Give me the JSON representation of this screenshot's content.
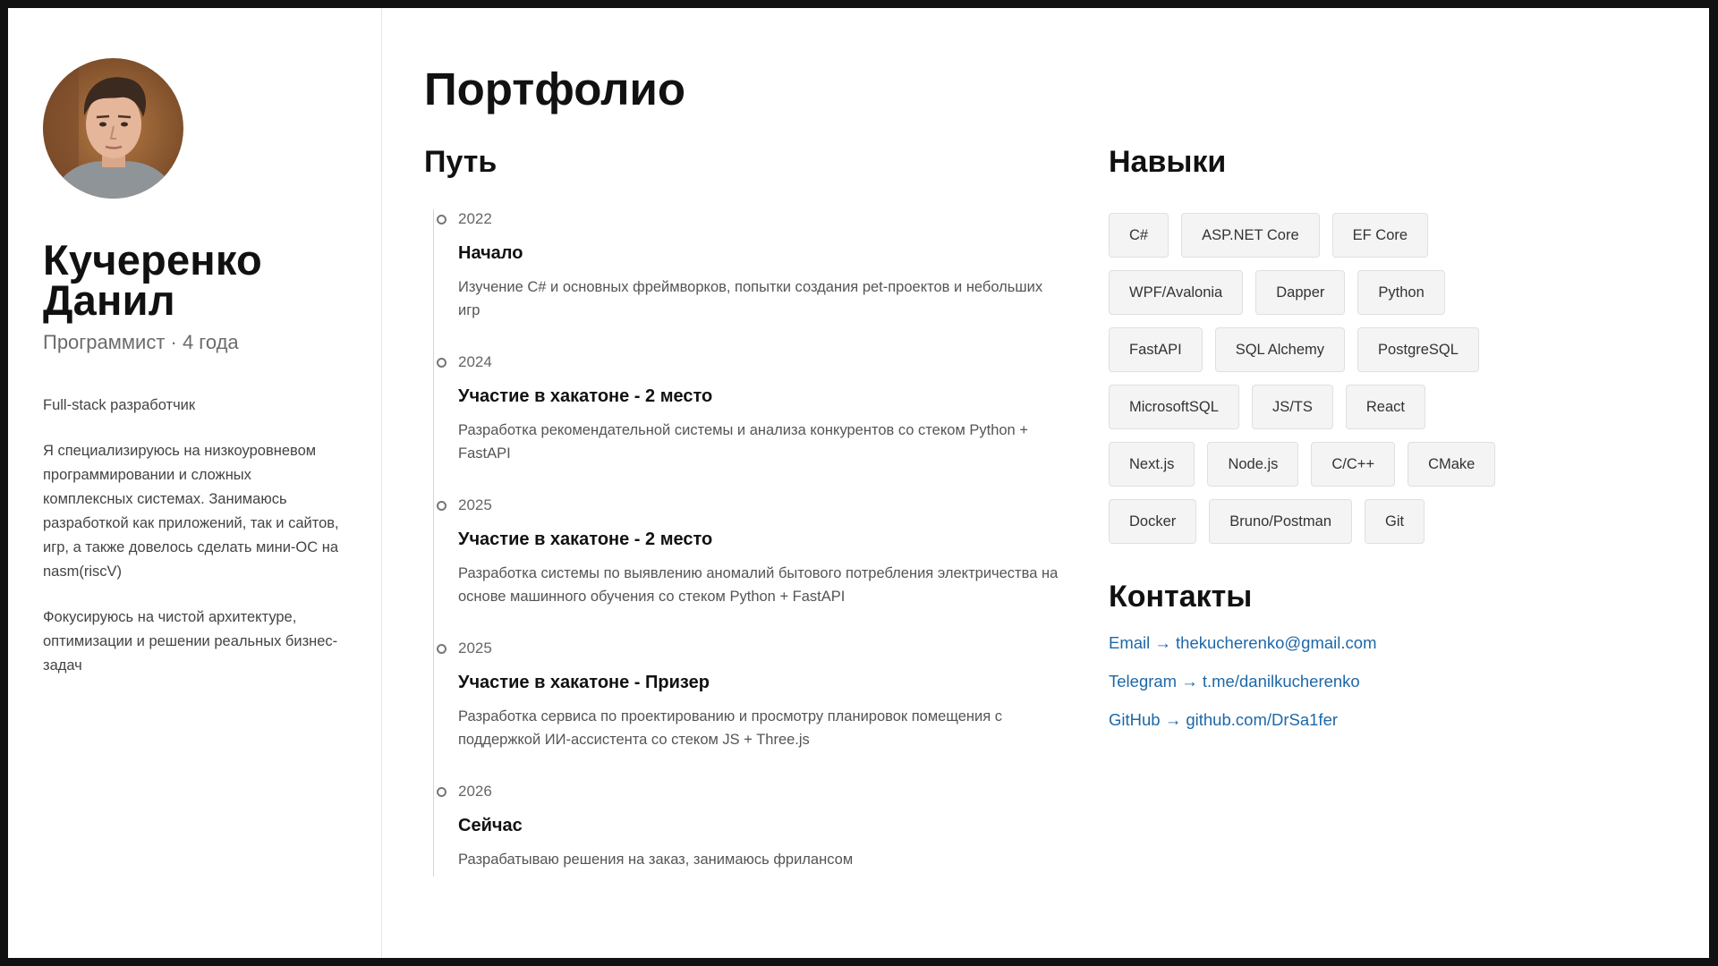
{
  "sidebar": {
    "name_line1": "Кучеренко",
    "name_line2": "Данил",
    "subtitle": "Программист · 4 года",
    "bio": [
      "Full-stack разработчик",
      "Я специализируюсь на низкоуровневом программировании и сложных комплексных системах. Занимаюсь разработкой как приложений, так и сайтов, игр, а также довелось сделать мини-ОС на nasm(riscV)",
      "Фокусируюсь на чистой архитектуре, оптимизации и решении реальных бизнес-задач"
    ]
  },
  "main": {
    "title": "Портфолио",
    "path_title": "Путь",
    "timeline": [
      {
        "year": "2022",
        "title": "Начало",
        "desc": "Изучение C# и основных фреймворков, попытки создания pet-проектов и небольших игр"
      },
      {
        "year": "2024",
        "title": "Участие в хакатоне - 2 место",
        "desc": "Разработка рекомендательной системы и анализа конкурентов со стеком Python + FastAPI"
      },
      {
        "year": "2025",
        "title": "Участие в хакатоне - 2 место",
        "desc": "Разработка системы по выявлению аномалий бытового потребления электричества на основе машинного обучения со стеком Python + FastAPI"
      },
      {
        "year": "2025",
        "title": "Участие в хакатоне - Призер",
        "desc": "Разработка сервиса по проектированию и просмотру планировок помещения с поддержкой ИИ-ассистента со стеком JS + Three.js"
      },
      {
        "year": "2026",
        "title": "Сейчас",
        "desc": "Разрабатываю решения на заказ, занимаюсь фрилансом"
      }
    ],
    "skills_title": "Навыки",
    "skills": [
      "C#",
      "ASP.NET Core",
      "EF Core",
      "WPF/Avalonia",
      "Dapper",
      "Python",
      "FastAPI",
      "SQL Alchemy",
      "PostgreSQL",
      "MicrosoftSQL",
      "JS/TS",
      "React",
      "Next.js",
      "Node.js",
      "C/C++",
      "CMake",
      "Docker",
      "Bruno/Postman",
      "Git"
    ],
    "contacts_title": "Контакты",
    "contacts": [
      "Email → thekucherenko@gmail.com",
      "Telegram → t.me/danilkucherenko",
      "GitHub → github.com/DrSa1fer"
    ]
  },
  "colors": {
    "accent_link": "#1e68a8",
    "frame_border": "#111111",
    "chip_bg": "#f4f4f4"
  }
}
